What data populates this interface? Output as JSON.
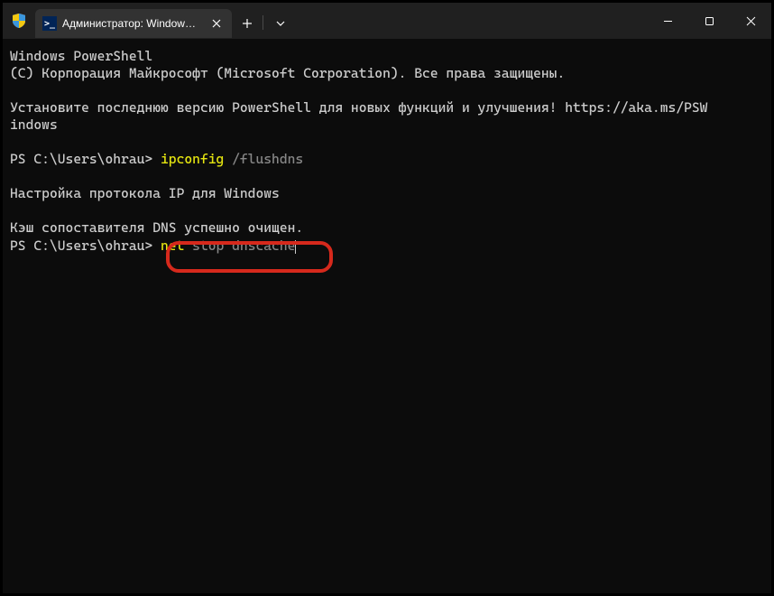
{
  "titlebar": {
    "tab_title": "Администратор: Windows PowerShell",
    "tab_icon_text": ">_"
  },
  "terminal": {
    "line1": "Windows PowerShell",
    "line2": "(C) Корпорация Майкрософт (Microsoft Corporation). Все права защищены.",
    "line3a": "Установите последнюю версию PowerShell для новых функций и улучшения! https://aka.ms/PSW",
    "line3b": "indows",
    "prompt1": "PS C:\\Users\\ohrau> ",
    "cmd1_name": "ipconfig",
    "cmd1_arg": " /flushdns",
    "line5": "Настройка протокола IP для Windows",
    "line6": "Кэш сопоставителя DNS успешно очищен.",
    "prompt2": "PS C:\\Users\\ohrau> ",
    "cmd2_name": "net",
    "cmd2_arg": " stop dnscache"
  }
}
